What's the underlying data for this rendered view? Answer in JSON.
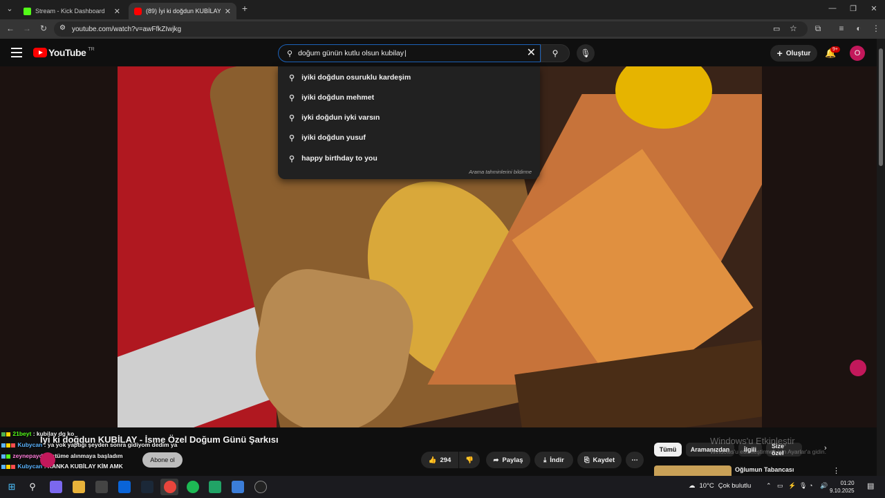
{
  "browser": {
    "tabs": [
      {
        "label": "Stream - Kick Dashboard",
        "color": "#53fc18"
      },
      {
        "label": "(89) İyi ki doğdun KUBİLAY - İs",
        "color": "#ff0000"
      }
    ],
    "new_tab": "+",
    "url": "youtube.com/watch?v=awFfkZIwjkg"
  },
  "youtube": {
    "logo_text": "YouTube",
    "country": "TR",
    "search_value": "doğum günün kutlu olsun kubilay",
    "suggestions": [
      "iyiki doğdun osuruklu kardeşim",
      "iyiki doğdun mehmet",
      "iyki doğdun iyki varsın",
      "iyiki doğdun yusuf",
      "happy birthday to you"
    ],
    "report_label": "Arama tahminlerini bildirme",
    "create_label": "Oluştur",
    "notif_badge": "9+",
    "avatar_letter": "O"
  },
  "video": {
    "title": "İyi ki doğdun KUBİLAY - İsme Özel Doğum Günü Şarkısı",
    "subscribe_label": "Abone ol",
    "likes": "294",
    "share_label": "Paylaş",
    "download_label": "İndir",
    "save_label": "Kaydet"
  },
  "chat": [
    {
      "user": "21beyt",
      "text": ": kubilay dg ko"
    },
    {
      "user": "Kubycan",
      "text": ": ya yok yaptığı şeyden sonra gidiyom dedim ya"
    },
    {
      "user": "zeynepayd",
      "text": ": üstüme alınmaya başladım"
    },
    {
      "user": "Kubycan",
      "text": ": KANKA KUBİLAY KİM AMK"
    }
  ],
  "filters": [
    "Tümü",
    "Aramanızdan",
    "İlgili",
    "Size özel"
  ],
  "recommendation": {
    "title": "Oğlumun Tabancası"
  },
  "watermark": {
    "line1": "Windows'u Etkinleştir",
    "line2": "Windows'u etkinleştirmek için Ayarlar'a gidin."
  },
  "taskbar": {
    "temperature": "10°C",
    "weather": "Çok bulutlu",
    "time": "01:20",
    "date": "9.10.2025"
  }
}
